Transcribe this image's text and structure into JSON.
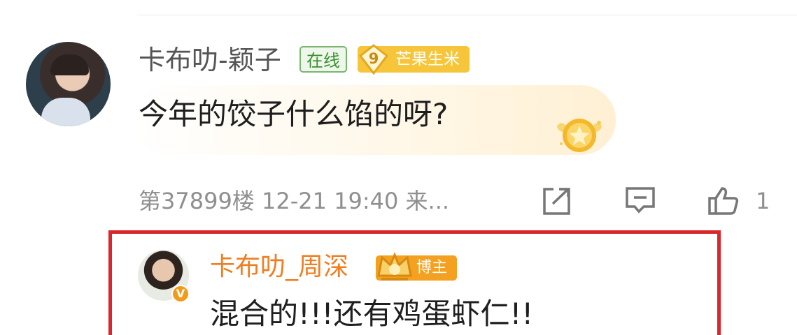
{
  "comment": {
    "username": "卡布叻-颖子",
    "online_label": "在线",
    "level_number": "9",
    "level_label": "芒果生米",
    "text": "今年的饺子什么馅的呀?",
    "floor": "第37899楼",
    "datetime": "12-21 19:40",
    "source": "来...",
    "like_count": "1"
  },
  "reply": {
    "username": "卡布叻_周深",
    "badge_label": "博主",
    "text": "混合的!!!还有鸡蛋虾仁!!"
  },
  "colors": {
    "highlight_border": "#d8262b",
    "reply_username": "#ef7e20",
    "online_badge": "#3c8f34",
    "level_badge": "#f6c53a",
    "blogger_badge": "#f4a020"
  },
  "icons": [
    "share-icon",
    "reply-icon",
    "like-icon",
    "medal-icon",
    "verified-icon"
  ]
}
